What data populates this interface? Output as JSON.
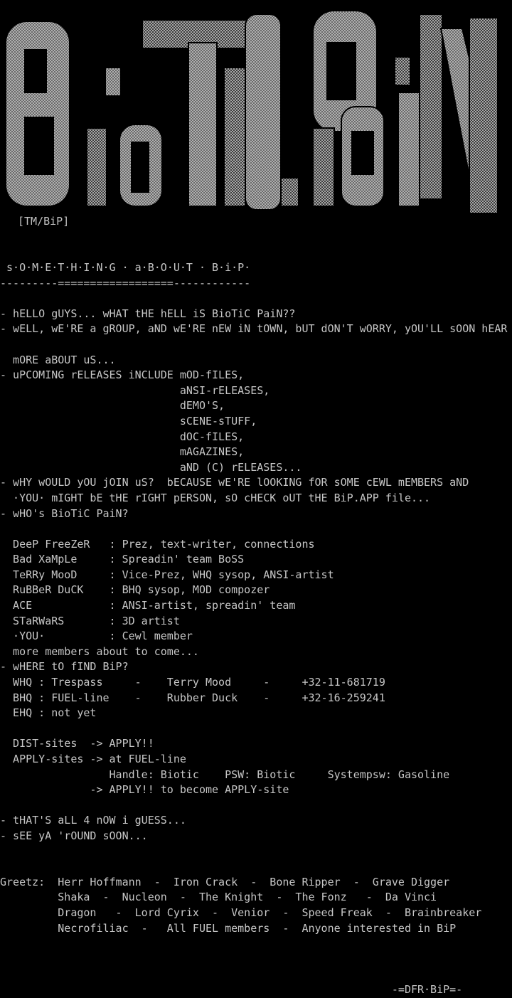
{
  "logo": {
    "text": "BioTiC PaiN",
    "tag": "[TM/BiP]"
  },
  "lines": [
    " s·O·M·E·T·H·I·N·G · a·B·O·U·T · B·i·P·",
    "---------==================------------",
    "",
    "- hELLO gUYS... wHAT tHE hELL iS BioTiC PaiN??",
    "- wELL, wE'RE a gROUP, aND wE'RE nEW iN tOWN, bUT dON'T wORRY, yOU'LL sOON hEAR",
    "",
    "  mORE aBOUT uS...",
    "- uPCOMING rELEASES iNCLUDE mOD-fILES,",
    "                            aNSI-rELEASES,",
    "                            dEMO'S,",
    "                            sCENE-sTUFF,",
    "                            dOC-fILES,",
    "                            mAGAZINES,",
    "                            aND (C) rELEASES...",
    "- wHY wOULD yOU jOIN uS?  bECAUSE wE'RE lOOKING fOR sOME cEWL mEMBERS aND",
    "  ·YOU· mIGHT bE tHE rIGHT pERSON, sO cHECK oUT tHE BiP.APP file...",
    "- wHO's BioTiC PaiN?",
    "",
    "  DeeP FreeZeR   : Prez, text-writer, connections",
    "  Bad XaMpLe     : Spreadin' team BoSS",
    "  TeRRy MooD     : Vice-Prez, WHQ sysop, ANSI-artist",
    "  RuBBeR DuCK    : BHQ sysop, MOD compozer",
    "  ACE            : ANSI-artist, spreadin' team",
    "  STaRWaRS       : 3D artist",
    "  ·YOU·          : Cewl member",
    "  more members about to come...",
    "- wHERE tO fIND BiP?",
    "  WHQ : Trespass     -    Terry Mood     -     +32-11-681719",
    "  BHQ : FUEL-line    -    Rubber Duck    -     +32-16-259241",
    "  EHQ : not yet",
    "",
    "  DIST-sites  -> APPLY!!",
    "  APPLY-sites -> at FUEL-line",
    "                 Handle: Biotic    PSW: Biotic     Systempsw: Gasoline",
    "              -> APPLY!! to become APPLY-site",
    "",
    "- tHAT'S aLL 4 nOW i gUESS...",
    "- sEE yA 'rOUND sOON...",
    "",
    "",
    "Greetz:  Herr Hoffmann  -  Iron Crack  -  Bone Ripper  -  Grave Digger",
    "         Shaka  -  Nucleon  -  The Knight  -  The Fonz   -  Da Vinci",
    "         Dragon   -  Lord Cyrix  -  Venior  -  Speed Freak  -  Brainbreaker",
    "         Necrofiliac  -   All FUEL members  -  Anyone interested in BiP",
    "",
    "",
    "",
    "                                                             -=DFR·BiP=-"
  ],
  "colors": {
    "background": "#000000",
    "text": "#c6c6c6",
    "logo_light": "#b4b4b4",
    "logo_dark": "#5a5a5a"
  }
}
